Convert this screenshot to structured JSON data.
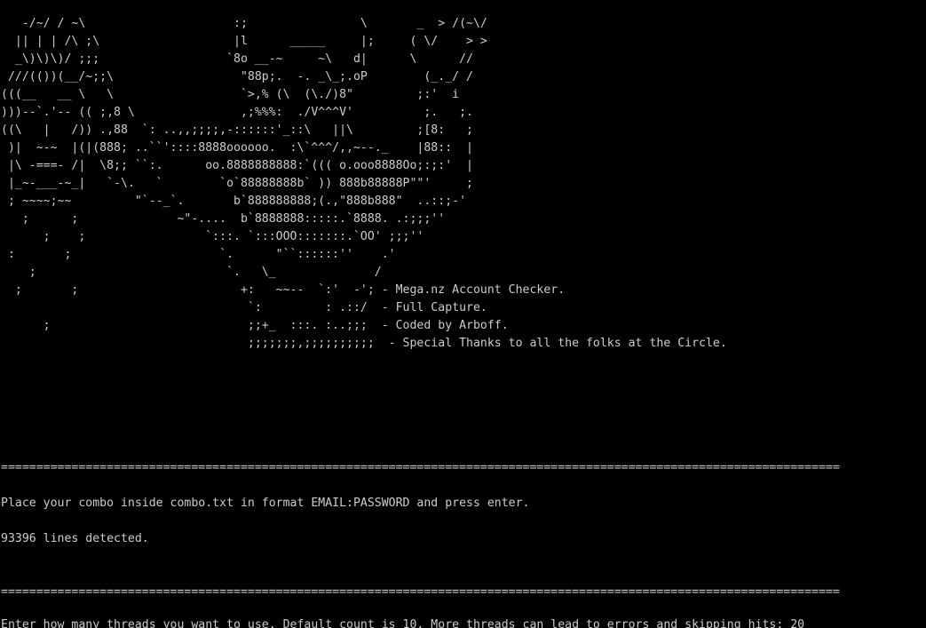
{
  "console": {
    "banner": [
      "   -/~/ / ~\\                     :;                \\       _  > /(~\\/",
      "  || | | /\\ ;\\                   |l      _____     |;     ( \\/    > >",
      "  _\\)\\)\\)/ ;;;                  `8o __-~     ~\\   d|      \\      //",
      " ///(())(__/~;;\\                  \"88p;.  -. _\\_;.oP        (_._/ /",
      "(((__   __ \\   \\                  `>,% (\\  (\\./)8\"         ;:'  i",
      ")))--`.'-- (( ;,8 \\               ,;%%%:  ./V^^^V'          ;.   ;.",
      "((\\   |   /)) .,88  `: ..,,;;;;,-::::::'_::\\   ||\\         ;[8:   ;",
      " )|  ~-~  |(|(888; ..``'::::8888oooooo.  :\\`^^^/,,~--._    |88::  |",
      " |\\ -===- /|  \\8;; ``:.      oo.8888888888:`((( o.ooo8888Oo;:;:'  |",
      " |_~-___-~_|   `-\\.   `        `o`88888888b` )) 888b88888P\"\"'     ;",
      " ; ~~~~;~~         \"`--_`.       b`888888888;(.,\"888b888\"  ..::;-'",
      "   ;      ;              ~\"-....  b`8888888:::::.`8888. .:;;;''",
      "      ;    ;                 `:::. `:::OOO:::::::.`OO' ;;;''",
      " :       ;                     `.      \"``::::::''    .'",
      "    ;                           `.   \\_              /",
      "  ;       ;                       +:   ~~--  `:'  -'; - Mega.nz Account Checker.",
      "                                   `:         : .::/  - Full Capture.",
      "      ;                            ;;+_  :::. :..;;;  - Coded by Arboff.",
      "                                   ;;;;;;;,;;;;;;;;;;  - Special Thanks to all the folks at the Circle."
    ],
    "separator": "=======================================================================================================================",
    "prompt_combo": "Place your combo inside combo.txt in format EMAIL:PASSWORD and press enter.",
    "lines_detected": "93396 lines detected.",
    "prompt_threads": "Enter how many threads you want to use. Default count is 10. More threads can lead to errors and skipping hits: 20"
  }
}
